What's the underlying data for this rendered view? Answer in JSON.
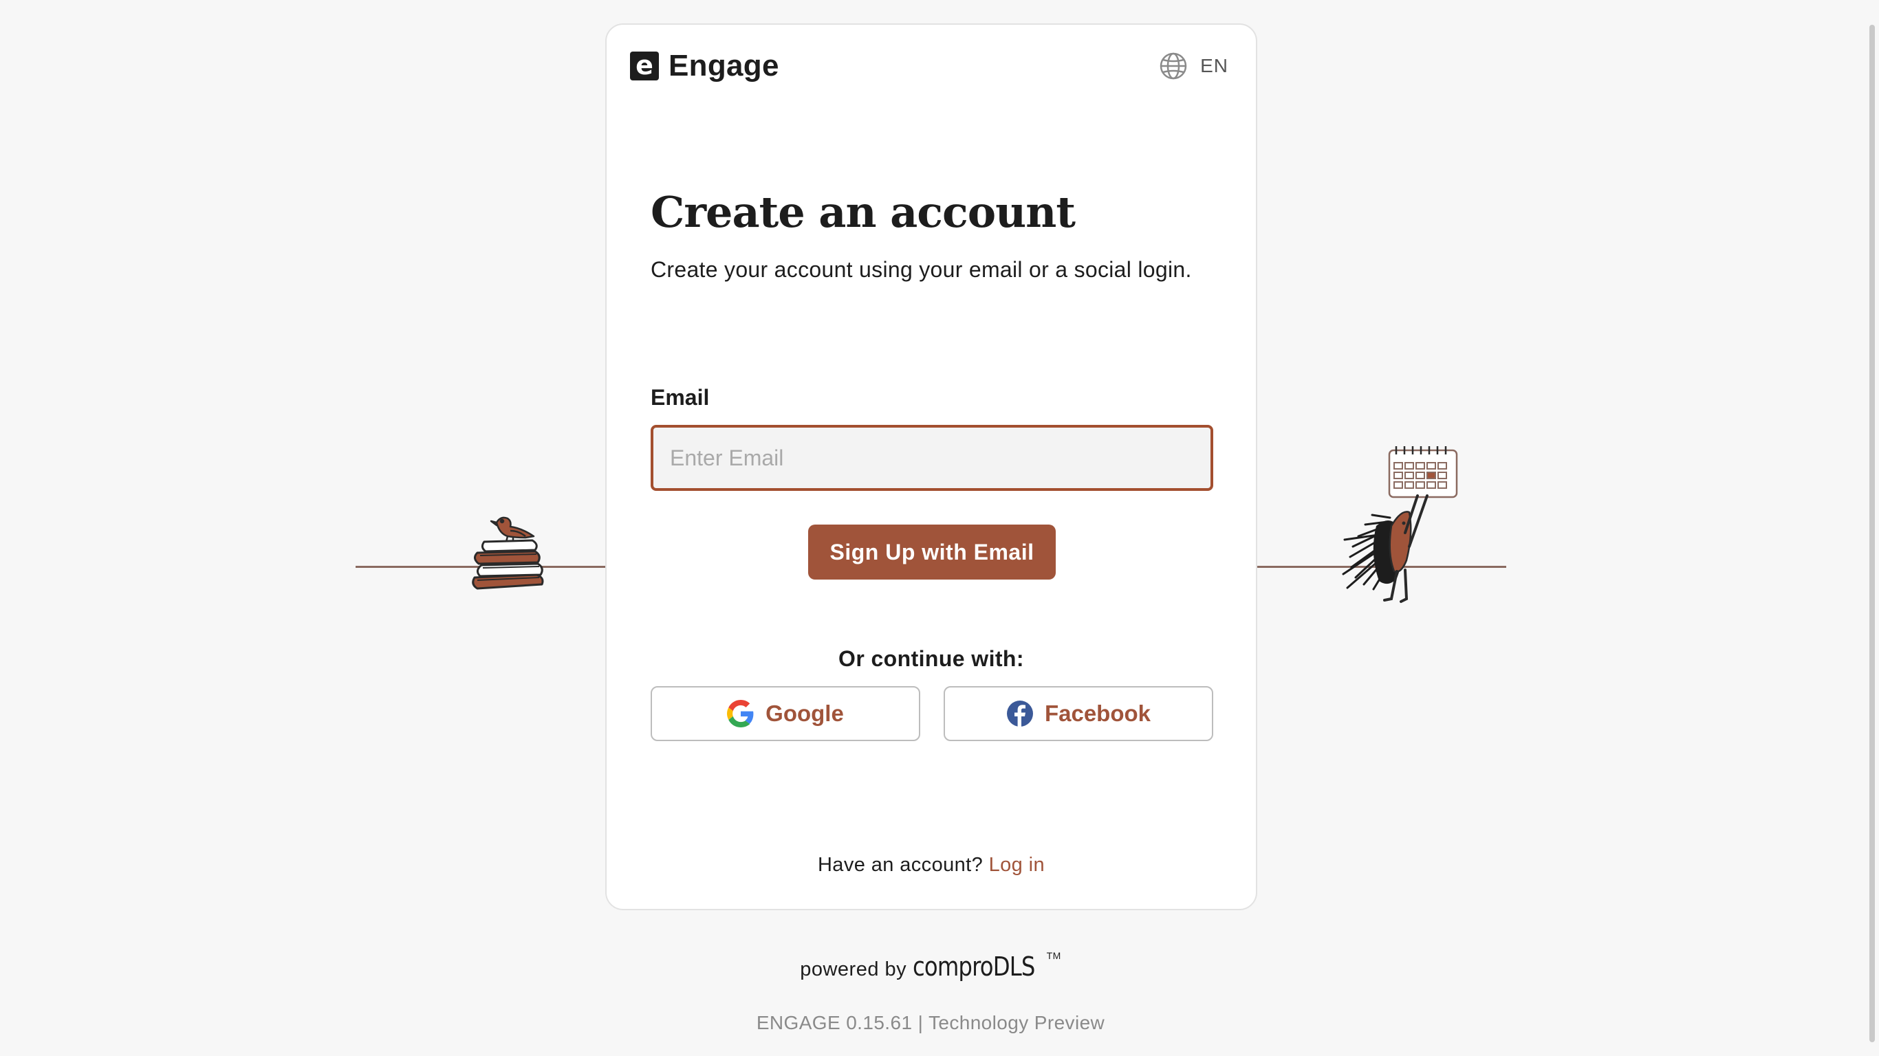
{
  "brand": {
    "name": "Engage",
    "logo_letter": "e"
  },
  "language": {
    "code": "EN",
    "icon": "globe-icon"
  },
  "form": {
    "title": "Create an account",
    "subtitle": "Create your account using your email or a social login.",
    "email_label": "Email",
    "email_placeholder": "Enter Email",
    "email_value": "",
    "submit_label": "Sign Up with Email",
    "divider_text": "Or continue with:",
    "social": {
      "google_label": "Google",
      "google_icon": "google-icon",
      "facebook_label": "Facebook",
      "facebook_icon": "facebook-icon"
    },
    "login_prompt": "Have an account?",
    "login_link": "Log in"
  },
  "footer": {
    "powered_prefix": "powered by",
    "powered_brand": "comproDLS",
    "powered_tm": "TM",
    "version_text": "ENGAGE 0.15.61 | Technology Preview"
  },
  "colors": {
    "accent": "#a0543a",
    "input_border": "#a34f2f",
    "background": "#f7f7f7",
    "card": "#ffffff",
    "facebook_blue": "#3b5998"
  },
  "illustrations": {
    "left": "bird-on-books-illustration",
    "right": "porcupine-with-calendar-illustration"
  }
}
